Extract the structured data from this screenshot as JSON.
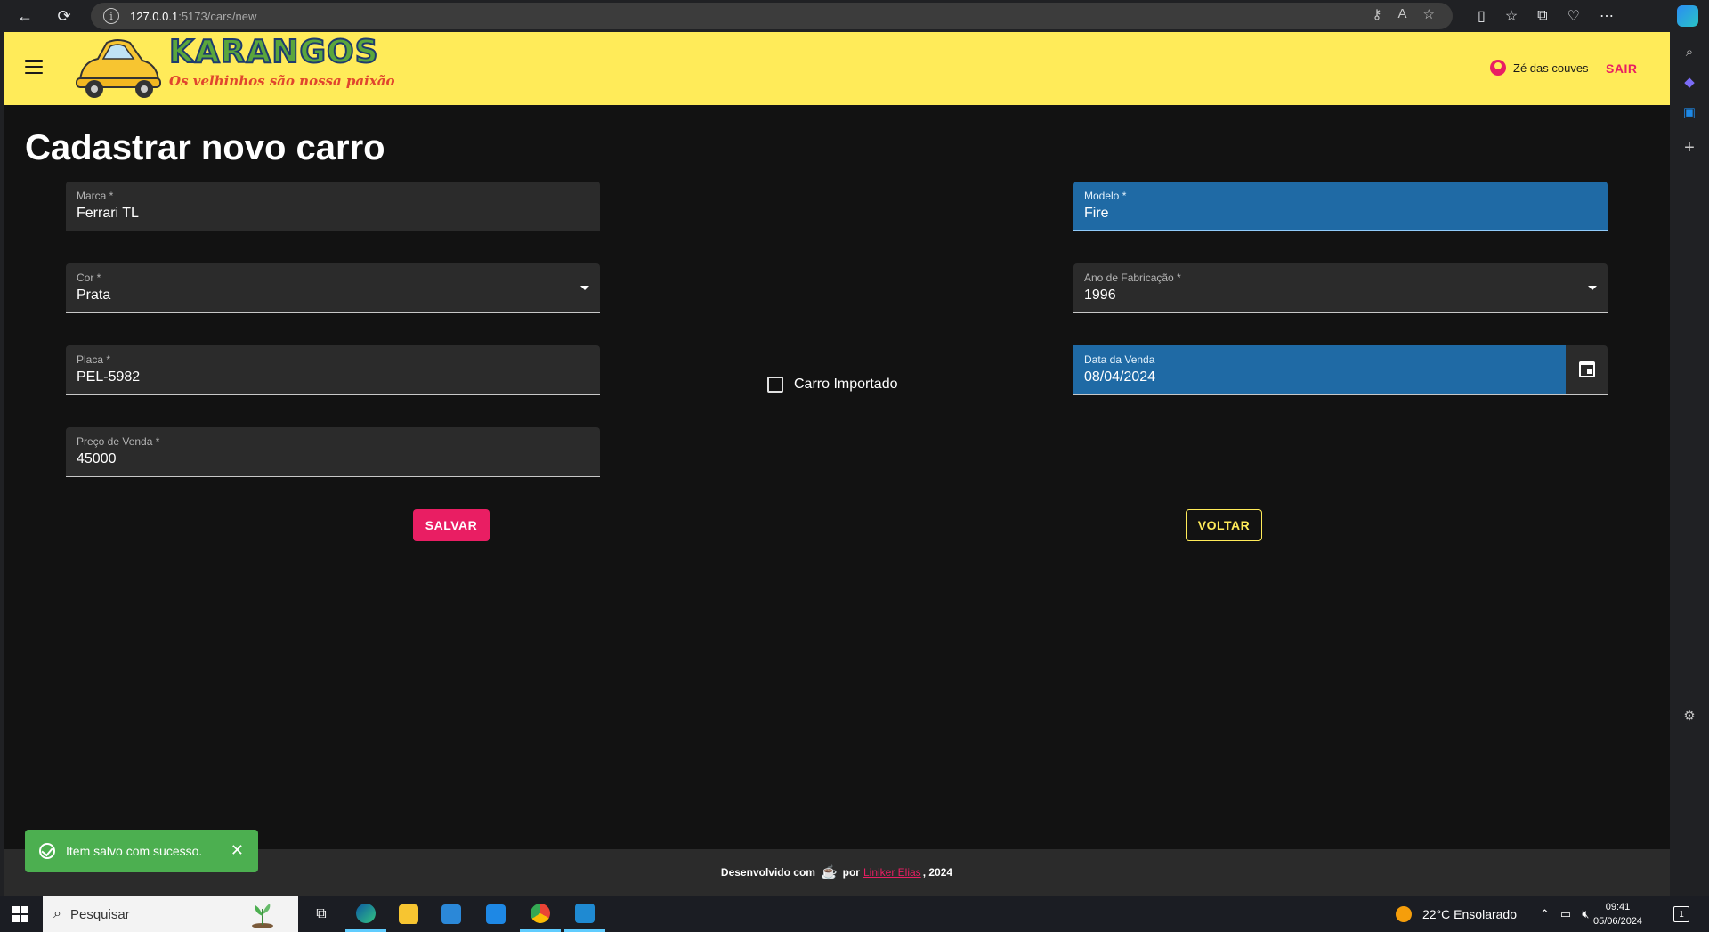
{
  "browser": {
    "url_host": "127.0.0.1",
    "url_path": ":5173/cars/new"
  },
  "header": {
    "logo_title": "KARANGOS",
    "logo_subtitle": "Os velhinhos são nossa paixão",
    "user_name": "Zé das couves",
    "logout_label": "SAIR"
  },
  "page": {
    "title": "Cadastrar novo carro"
  },
  "form": {
    "marca": {
      "label": "Marca *",
      "value": "Ferrari TL"
    },
    "modelo": {
      "label": "Modelo *",
      "value": "Fire"
    },
    "cor": {
      "label": "Cor *",
      "value": "Prata"
    },
    "ano": {
      "label": "Ano de Fabricação *",
      "value": "1996"
    },
    "placa": {
      "label": "Placa *",
      "value": "PEL-5982"
    },
    "importado": {
      "label": "Carro Importado",
      "checked": false
    },
    "data_venda": {
      "label": "Data da Venda",
      "value": "08/04/2024"
    },
    "preco": {
      "label": "Preço de Venda *",
      "value": "45000"
    },
    "save_label": "SALVAR",
    "back_label": "VOLTAR"
  },
  "footer": {
    "prefix": "Desenvolvido com",
    "cup": "☕",
    "by": "por",
    "author": "Liniker Elias",
    "suffix": ", 2024"
  },
  "snackbar": {
    "message": "Item salvo com sucesso.",
    "close": "✕"
  },
  "taskbar": {
    "search_placeholder": "Pesquisar",
    "weather": "22°C  Ensolarado",
    "time": "09:41",
    "date": "05/06/2024",
    "notifications": "1"
  },
  "colors": {
    "appbar": "#ffeb59",
    "accent": "#e91e63",
    "focused_field": "#1f6aa5",
    "snackbar": "#4caf50"
  }
}
